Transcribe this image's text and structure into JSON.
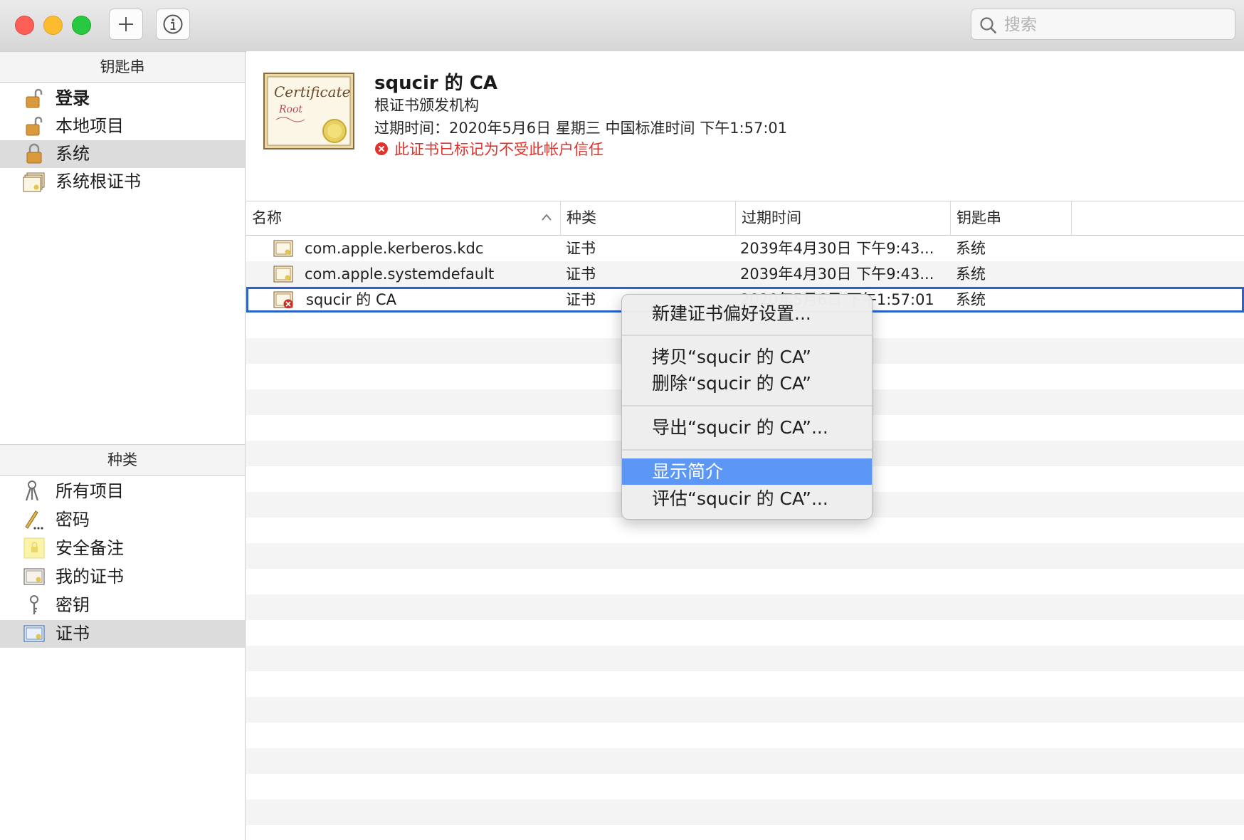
{
  "toolbar": {
    "add_icon": "plus-icon",
    "info_icon": "info-icon",
    "search_placeholder": "搜索"
  },
  "sidebar": {
    "keychains_header": "钥匙串",
    "keychains": [
      {
        "label": "登录",
        "icon": "unlocked-padlock-icon",
        "bold": true
      },
      {
        "label": "本地项目",
        "icon": "unlocked-padlock-icon"
      },
      {
        "label": "系统",
        "icon": "locked-padlock-icon",
        "selected": true
      },
      {
        "label": "系统根证书",
        "icon": "certificate-stack-icon"
      }
    ],
    "categories_header": "种类",
    "categories": [
      {
        "label": "所有项目",
        "icon": "keys-icon"
      },
      {
        "label": "密码",
        "icon": "pencil-icon"
      },
      {
        "label": "安全备注",
        "icon": "note-icon"
      },
      {
        "label": "我的证书",
        "icon": "certificate-icon"
      },
      {
        "label": "密钥",
        "icon": "key-icon"
      },
      {
        "label": "证书",
        "icon": "certificate-icon",
        "selected": true
      }
    ]
  },
  "info": {
    "title": "squcir 的 CA",
    "subtitle": "根证书颁发机构",
    "expiry": "过期时间：2020年5月6日 星期三 中国标准时间 下午1:57:01",
    "warning": "此证书已标记为不受此帐户信任",
    "cert_word": "Certificate",
    "cert_sub": "Root",
    "warning_color": "#e0322b"
  },
  "table": {
    "columns": [
      "名称",
      "种类",
      "过期时间",
      "钥匙串"
    ],
    "rows": [
      {
        "name": "com.apple.kerberos.kdc",
        "kind": "证书",
        "expires": "2039年4月30日 下午9:43...",
        "keychain": "系统"
      },
      {
        "name": "com.apple.systemdefault",
        "kind": "证书",
        "expires": "2039年4月30日 下午9:43...",
        "keychain": "系统"
      },
      {
        "name": "squcir 的 CA",
        "kind": "证书",
        "expires": "2020年5月6日 下午1:57:01",
        "keychain": "系统",
        "untrusted": true,
        "selected": true
      }
    ]
  },
  "context_menu": {
    "items": [
      {
        "label": "新建证书偏好设置..."
      },
      {
        "label": "拷贝“squcir 的 CA”"
      },
      {
        "label": "删除“squcir 的 CA”"
      },
      {
        "label": "导出“squcir 的 CA”..."
      },
      {
        "label": "显示简介",
        "highlighted": true
      },
      {
        "label": "评估“squcir 的 CA”..."
      }
    ],
    "highlight_color": "#5c97f5"
  }
}
